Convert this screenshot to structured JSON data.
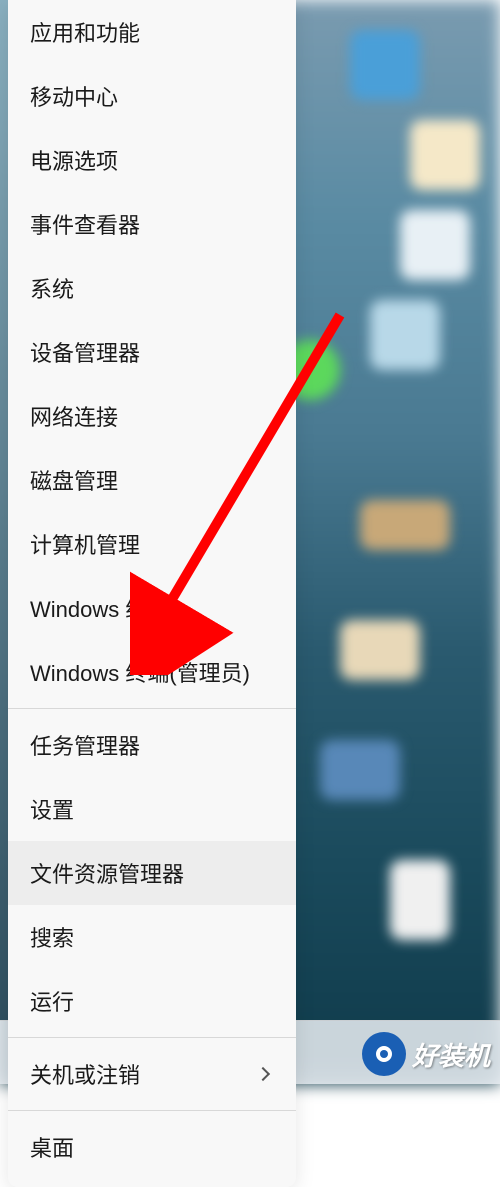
{
  "context_menu": {
    "items": [
      {
        "label": "应用和功能",
        "has_chevron": false
      },
      {
        "label": "移动中心",
        "has_chevron": false
      },
      {
        "label": "电源选项",
        "has_chevron": false
      },
      {
        "label": "事件查看器",
        "has_chevron": false
      },
      {
        "label": "系统",
        "has_chevron": false
      },
      {
        "label": "设备管理器",
        "has_chevron": false
      },
      {
        "label": "网络连接",
        "has_chevron": false
      },
      {
        "label": "磁盘管理",
        "has_chevron": false
      },
      {
        "label": "计算机管理",
        "has_chevron": false
      },
      {
        "label": "Windows 终端",
        "has_chevron": false
      },
      {
        "label": "Windows 终端(管理员)",
        "has_chevron": false
      },
      {
        "label": "任务管理器",
        "has_chevron": false
      },
      {
        "label": "设置",
        "has_chevron": false
      },
      {
        "label": "文件资源管理器",
        "has_chevron": false
      },
      {
        "label": "搜索",
        "has_chevron": false
      },
      {
        "label": "运行",
        "has_chevron": false
      },
      {
        "label": "关机或注销",
        "has_chevron": true
      },
      {
        "label": "桌面",
        "has_chevron": false
      }
    ],
    "dividers_after": [
      10,
      15,
      16
    ],
    "hovered_index": 13
  },
  "annotation": {
    "arrow_color": "#ff0000",
    "points_to_index": 11
  },
  "watermark": {
    "text": "好装机"
  }
}
